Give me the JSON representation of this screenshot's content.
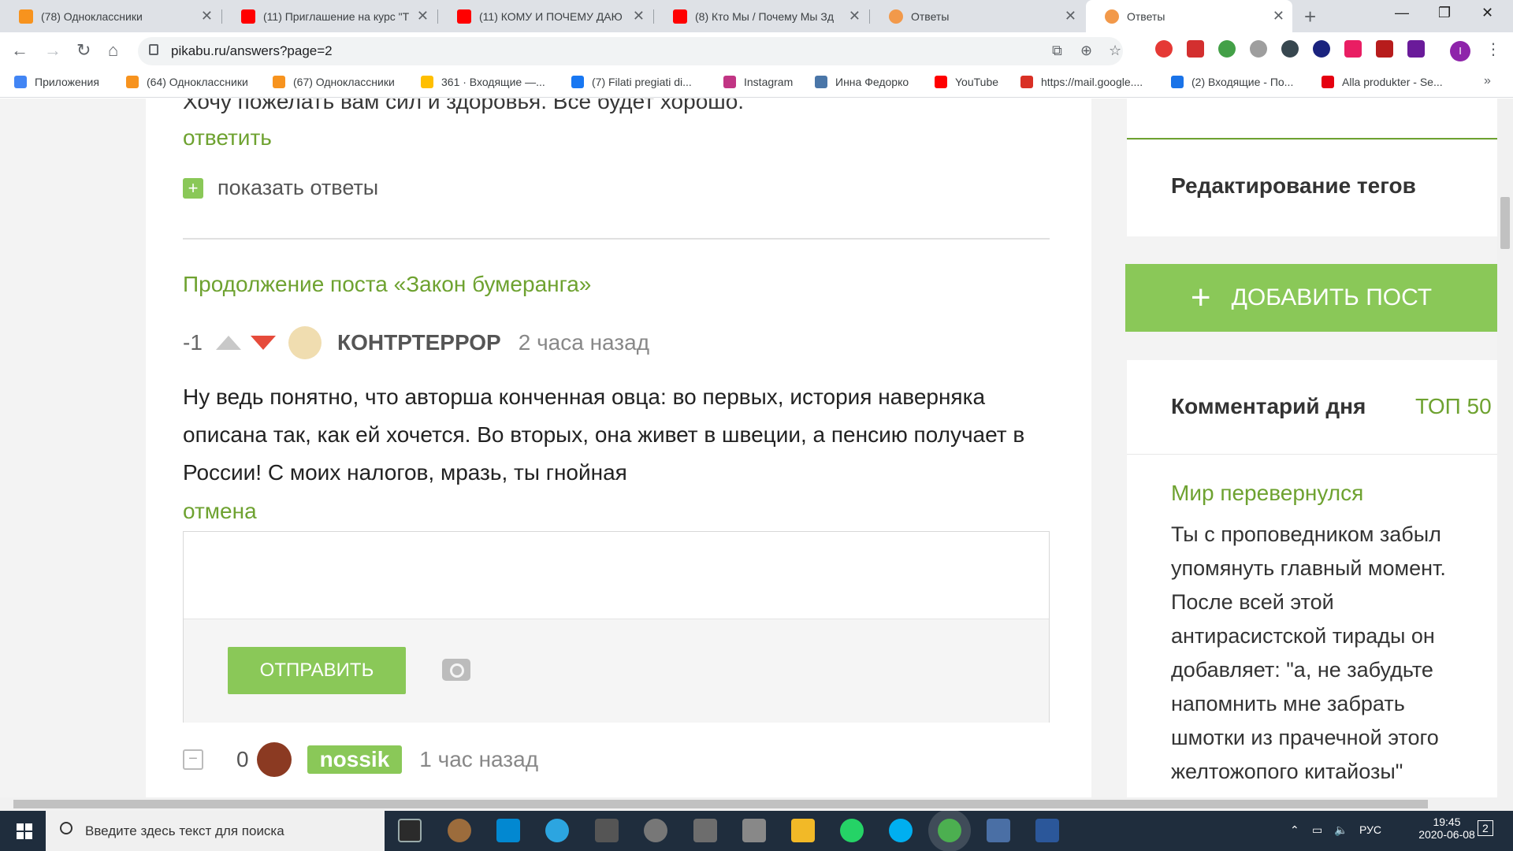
{
  "browser": {
    "tabs": [
      {
        "title": "(78) Одноклассники",
        "color": "#f7931e"
      },
      {
        "title": "(11) Приглашение на курс \"Т",
        "color": "#ff0000"
      },
      {
        "title": "(11) КОМУ И ПОЧЕМУ ДАЮ",
        "color": "#ff0000"
      },
      {
        "title": "(8) Кто Мы / Почему Мы Зд",
        "color": "#ff0000"
      },
      {
        "title": "Ответы",
        "color": "#f2994a"
      },
      {
        "title": "Ответы",
        "color": "#f2994a"
      }
    ],
    "url": "pikabu.ru/answers?page=2",
    "profile_initial": "I",
    "bookmarks": [
      {
        "label": "Приложения",
        "color": "#4285f4"
      },
      {
        "label": "(64) Одноклассники",
        "color": "#f7931e"
      },
      {
        "label": "(67) Одноклассники",
        "color": "#f7931e"
      },
      {
        "label": "361 · Входящие —...",
        "color": "#ffbf00"
      },
      {
        "label": "(7) Filati pregiati di...",
        "color": "#1877f2"
      },
      {
        "label": "Instagram",
        "color": "#c13584"
      },
      {
        "label": "Инна Федорко",
        "color": "#4a76a8"
      },
      {
        "label": "YouTube",
        "color": "#ff0000"
      },
      {
        "label": "https://mail.google....",
        "color": "#d93025"
      },
      {
        "label": "(2) Входящие - По...",
        "color": "#1a73e8"
      },
      {
        "label": "Alla produkter - Se...",
        "color": "#e50010"
      }
    ]
  },
  "page": {
    "cut_text": "Хочу пожелать вам сил и здоровья. Всё будет хорошо.",
    "reply_link": "ответить",
    "show_answers": "показать ответы",
    "post_title": "Продолжение поста «Закон бумеранга»",
    "comment": {
      "score": "-1",
      "author": "КОНТРТЕРРОР",
      "time": "2 часа назад",
      "text": "Ну ведь понятно, что авторша конченная овца: во первых, история наверняка описана так, как ей хочется. Во вторых, она живет в швеции, а пенсию получает в России! С моих налогов, мразь, ты гнойная"
    },
    "cancel_link": "отмена",
    "send_button": "ОТПРАВИТЬ",
    "comment2": {
      "collapse": "−",
      "score": "0",
      "author": "nossik",
      "time": "1 час назад"
    }
  },
  "sidebar": {
    "edit_tags": "Редактирование тегов",
    "add_post": "ДОБАВИТЬ ПОСТ",
    "comment_of_day": "Комментарий дня",
    "top50": "ТОП 50",
    "day_title": "Мир перевернулся",
    "day_text": "Ты с проповедником забыл упомянуть главный момент. После всей этой антирасистской тирады он добавляет: \"а, не забудьте напомнить мне забрать шмотки из прачечной этого желтожопого китайозы\""
  },
  "taskbar": {
    "search_placeholder": "Введите здесь текст для поиска",
    "lang": "РУС",
    "time": "19:45",
    "date": "2020-06-08",
    "notifications": "2"
  }
}
